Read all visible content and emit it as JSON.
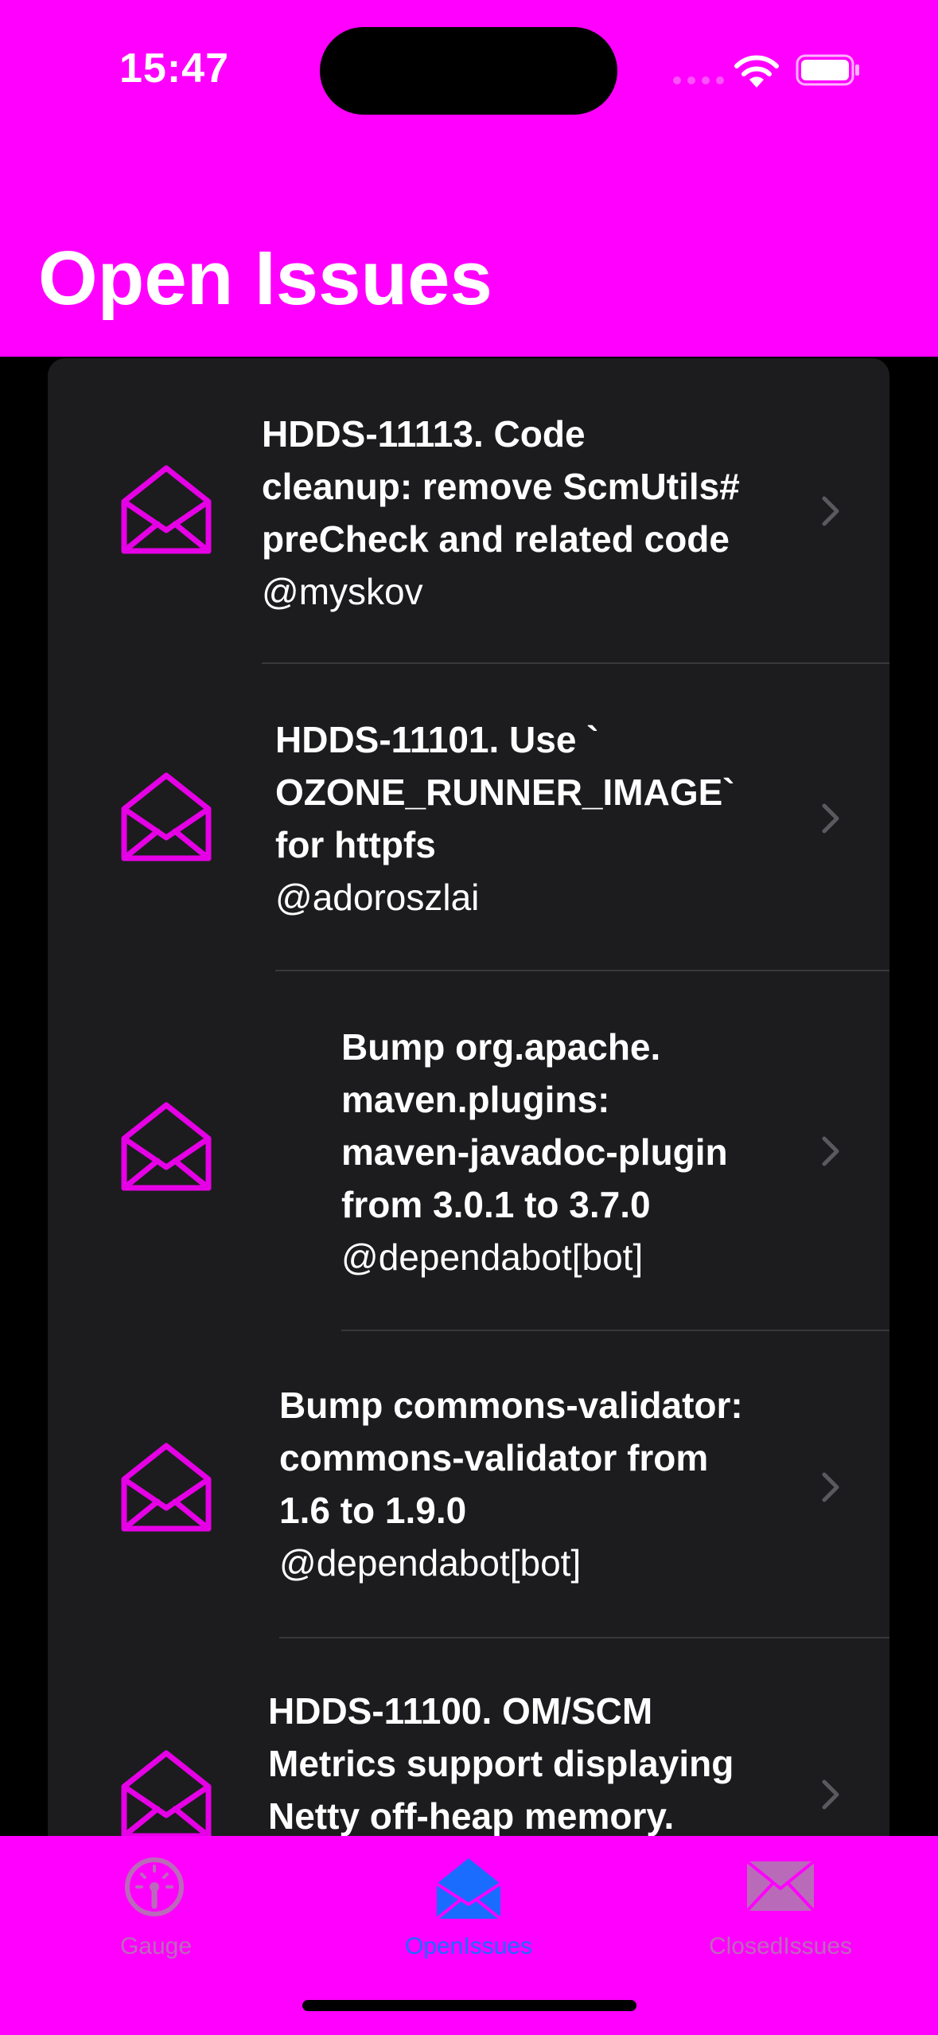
{
  "status_bar": {
    "time": "15:47"
  },
  "header": {
    "title": "Open Issues"
  },
  "colors": {
    "accent": "#ff00ff",
    "icon": "#e600e6",
    "tab_active": "#1a6cff",
    "tab_inactive": "#b96bb9",
    "list_bg": "#1c1c1e"
  },
  "issues": [
    {
      "title_lines": [
        "HDDS-11113. Code",
        "cleanup: remove ScmUtils#",
        "preCheck and related code"
      ],
      "author": "@myskov",
      "icon": "envelope-open-icon"
    },
    {
      "title_lines": [
        "HDDS-11101. Use `",
        "OZONE_RUNNER_IMAGE`",
        "for httpfs"
      ],
      "author": "@adoroszlai",
      "icon": "envelope-open-icon"
    },
    {
      "title_lines": [
        "Bump org.apache.",
        "maven.plugins:",
        "maven-javadoc-plugin",
        "from 3.0.1 to 3.7.0"
      ],
      "author": "@dependabot[bot]",
      "icon": "envelope-open-icon"
    },
    {
      "title_lines": [
        "Bump commons-validator:",
        "commons-validator from",
        "1.6 to 1.9.0"
      ],
      "author": "@dependabot[bot]",
      "icon": "envelope-open-icon"
    },
    {
      "title_lines": [
        "HDDS-11100. OM/SCM",
        "Metrics support displaying",
        "Netty off-heap memory."
      ],
      "author": "",
      "icon": "envelope-open-icon"
    }
  ],
  "tabbar": {
    "tabs": [
      {
        "label": "Gauge",
        "icon": "gauge-icon",
        "active": false
      },
      {
        "label": "OpenIssues",
        "icon": "envelope-open-icon",
        "active": true
      },
      {
        "label": "ClosedIssues",
        "icon": "envelope-closed-icon",
        "active": false
      }
    ]
  }
}
